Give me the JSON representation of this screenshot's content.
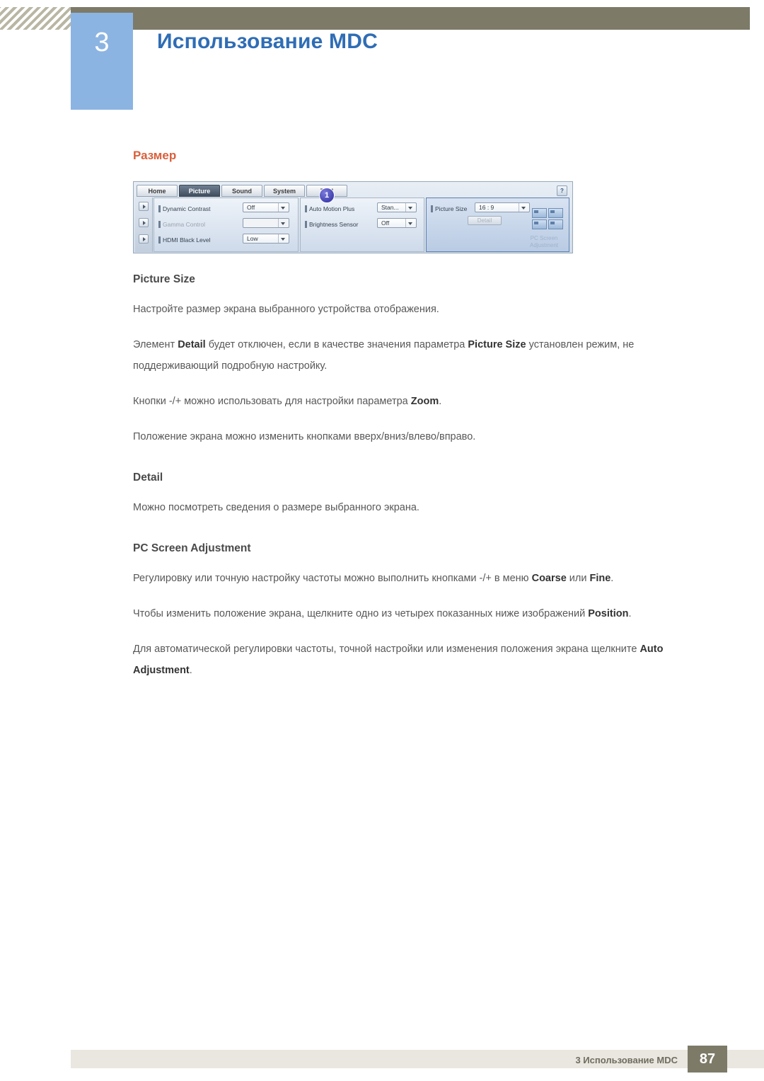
{
  "header": {
    "chapter_number": "3",
    "chapter_title": "Использование MDC"
  },
  "section": {
    "title": "Размер"
  },
  "mdc_panel": {
    "tabs": [
      {
        "label": "Home",
        "active": false
      },
      {
        "label": "Picture",
        "active": true
      },
      {
        "label": "Sound",
        "active": false
      },
      {
        "label": "System",
        "active": false
      },
      {
        "label": "Tool",
        "active": false
      }
    ],
    "help_icon": "?",
    "left_controls": [
      {
        "label": "Dynamic Contrast",
        "value": "Off",
        "disabled": false
      },
      {
        "label": "Gamma Control",
        "value": "",
        "disabled": true
      },
      {
        "label": "HDMI Black Level",
        "value": "Low",
        "disabled": false
      }
    ],
    "mid_controls": [
      {
        "label": "Auto Motion Plus",
        "value": "Stan...",
        "disabled": false
      },
      {
        "label": "Brightness Sensor",
        "value": "Off",
        "disabled": false
      }
    ],
    "right_panel": {
      "label": "Picture Size",
      "value": "16 : 9",
      "detail_button": "Detail",
      "callout": "1",
      "pc_screen_adjustment": "PC Screen Adjustment"
    }
  },
  "body": {
    "picture_size_heading": "Picture Size",
    "picture_size_p1": "Настройте размер экрана выбранного устройства отображения.",
    "picture_size_p2_a": "Элемент ",
    "picture_size_p2_b": "Detail",
    "picture_size_p2_c": " будет отключен, если в качестве значения параметра ",
    "picture_size_p2_d": "Picture Size",
    "picture_size_p2_e": " установлен режим, не поддерживающий подробную настройку.",
    "picture_size_p3_a": "Кнопки -/+ можно использовать для настройки параметра ",
    "picture_size_p3_b": "Zoom",
    "picture_size_p3_c": ".",
    "picture_size_p4": "Положение экрана можно изменить кнопками вверх/вниз/влево/вправо.",
    "detail_heading": "Detail",
    "detail_p1": "Можно посмотреть сведения о размере выбранного экрана.",
    "pcsa_heading": "PC Screen Adjustment",
    "pcsa_p1_a": "Регулировку или точную настройку частоты можно выполнить кнопками -/+ в меню ",
    "pcsa_p1_b": "Coarse",
    "pcsa_p1_c": " или ",
    "pcsa_p1_d": "Fine",
    "pcsa_p1_e": ".",
    "pcsa_p2_a": "Чтобы изменить положение экрана, щелкните одно из четырех показанных ниже изображений ",
    "pcsa_p2_b": "Position",
    "pcsa_p2_c": ".",
    "pcsa_p3_a": "Для автоматической регулировки частоты, точной настройки или изменения положения экрана щелкните ",
    "pcsa_p3_b": "Auto Adjustment",
    "pcsa_p3_c": "."
  },
  "footer": {
    "text": "3 Использование MDC",
    "page": "87"
  }
}
